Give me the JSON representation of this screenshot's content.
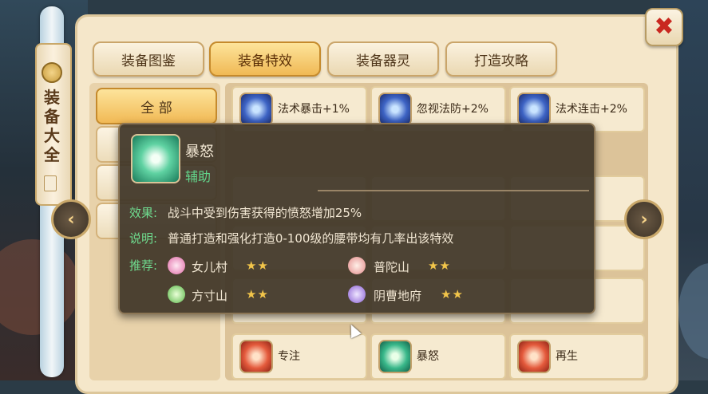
{
  "side_scroll": {
    "title": "装备大全"
  },
  "tabs": [
    {
      "label": "装备图鉴",
      "active": false
    },
    {
      "label": "装备特效",
      "active": true
    },
    {
      "label": "装备器灵",
      "active": false
    },
    {
      "label": "打造攻略",
      "active": false
    }
  ],
  "categories": [
    {
      "label": "全 部",
      "active": true
    }
  ],
  "effects": [
    {
      "label": "法术暴击+1%",
      "icon": "blue-swirl-icon"
    },
    {
      "label": "忽视法防+2%",
      "icon": "blue-swirl-icon"
    },
    {
      "label": "法术连击+2%",
      "icon": "blue-swirl-icon"
    },
    {
      "label": "专注",
      "icon": "red-lotus-icon"
    },
    {
      "label": "暴怒",
      "icon": "green-swirl-icon"
    },
    {
      "label": "再生",
      "icon": "red-lotus-icon"
    }
  ],
  "tooltip": {
    "name": "暴怒",
    "type": "辅助",
    "effect_key": "效果:",
    "effect_text": "战斗中受到伤害获得的愤怒增加25%",
    "desc_key": "说明:",
    "desc_text": "普通打造和强化打造0-100级的腰带均有几率出该特效",
    "recommend_key": "推荐:",
    "recommend": [
      {
        "name": "女儿村",
        "stars": "★★"
      },
      {
        "name": "普陀山",
        "stars": "★★"
      },
      {
        "name": "方寸山",
        "stars": "★★"
      },
      {
        "name": "阴曹地府",
        "stars": "★★"
      }
    ]
  },
  "close": {
    "symbol": "✖"
  },
  "nav": {
    "left": "‹",
    "right": "›"
  }
}
